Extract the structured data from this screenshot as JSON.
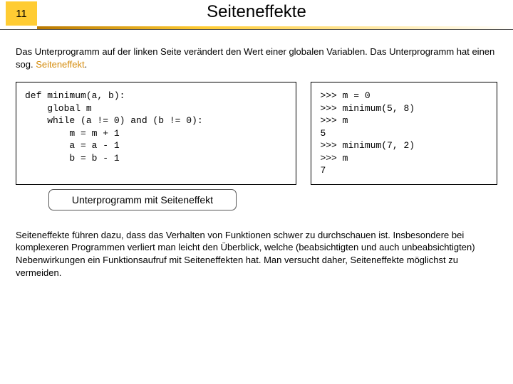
{
  "header": {
    "slide_number": "11",
    "title": "Seiteneffekte"
  },
  "intro": {
    "text_a": "Das Unterprogramm auf der linken Seite verändert den Wert einer globalen Variablen. Das Unterprogramm hat einen sog. ",
    "term": "Seiteneffekt",
    "text_b": "."
  },
  "code_left": "def minimum(a, b):\n    global m\n    while (a != 0) and (b != 0):\n        m = m + 1\n        a = a - 1\n        b = b - 1",
  "code_right": ">>> m = 0\n>>> minimum(5, 8)\n>>> m\n5\n>>> minimum(7, 2)\n>>> m\n7",
  "callout": "Unterprogramm mit Seiteneffekt",
  "outro": "Seiteneffekte führen dazu, dass das Verhalten von Funktionen schwer zu durchschauen ist. Insbesondere bei komplexeren Programmen verliert man leicht den Überblick, welche (beabsichtigten und auch unbeabsichtigten) Nebenwirkungen ein Funktionsaufruf mit Seiteneffekten hat. Man versucht daher, Seiteneffekte möglichst zu vermeiden."
}
